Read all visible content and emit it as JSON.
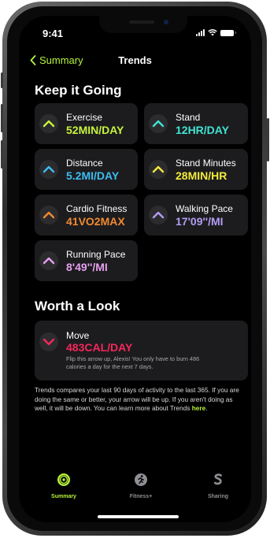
{
  "status_bar": {
    "time": "9:41"
  },
  "nav": {
    "back_label": "Summary",
    "title": "Trends"
  },
  "sections": {
    "keep_going": "Keep it Going",
    "worth_look": "Worth a Look"
  },
  "trends": [
    {
      "label": "Exercise",
      "value": "52MIN/DAY",
      "color": "#c8f23d",
      "direction": "up"
    },
    {
      "label": "Stand",
      "value": "12HR/DAY",
      "color": "#41e4d2",
      "direction": "up"
    },
    {
      "label": "Distance",
      "value": "5.2MI/DAY",
      "color": "#3ebdf2",
      "direction": "up"
    },
    {
      "label": "Stand Minutes",
      "value": "28MIN/HR",
      "color": "#f4ea3e",
      "direction": "up"
    },
    {
      "label": "Cardio Fitness",
      "value": "41VO2MAX",
      "color": "#f08a30",
      "direction": "up"
    },
    {
      "label": "Walking Pace",
      "value": "17'09''/MI",
      "color": "#b49cf4",
      "direction": "up"
    },
    {
      "label": "Running Pace",
      "value": "8'49''/MI",
      "color": "#e79ff0",
      "direction": "up"
    }
  ],
  "worth_a_look": {
    "label": "Move",
    "value": "483CAL/DAY",
    "color": "#f5275a",
    "direction": "down",
    "note": "Flip this arrow up, Alexis! You only have to burn 486 calories a day for the next 7 days."
  },
  "description": {
    "text": "Trends compares your last 90 days of activity to the last 365. If you are doing the same or better, your arrow will be up. If you aren't doing as well, it will be down. You can learn more about Trends ",
    "link": "here",
    "suffix": "."
  },
  "tabs": [
    {
      "label": "Summary",
      "icon": "activity-rings-icon",
      "active": true
    },
    {
      "label": "Fitness+",
      "icon": "running-figure-icon",
      "active": false
    },
    {
      "label": "Sharing",
      "icon": "sharing-icon",
      "active": false
    }
  ],
  "colors": {
    "accent": "#b6f33b",
    "card": "#1c1c1e",
    "background": "#000000"
  }
}
